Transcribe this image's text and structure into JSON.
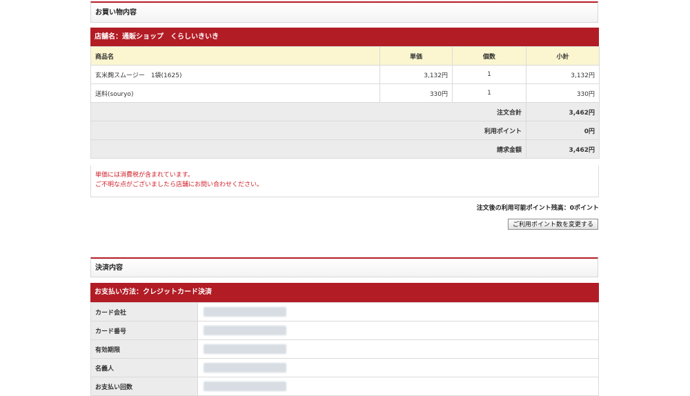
{
  "order": {
    "section_title": "お買い物内容",
    "shop_label": "店舗名：通販ショップ　くらしいきいき",
    "headers": {
      "name": "商品名",
      "unit_price": "単価",
      "qty": "個数",
      "subtotal": "小計"
    },
    "items": [
      {
        "name": "玄米麹スムージー　1袋(1625)",
        "unit_price": "3,132円",
        "qty": "1",
        "subtotal": "3,132円"
      },
      {
        "name": "送料(souryo)",
        "unit_price": "330円",
        "qty": "1",
        "subtotal": "330円"
      }
    ],
    "summary": [
      {
        "label": "注文合計",
        "value": "3,462円"
      },
      {
        "label": "利用ポイント",
        "value": "0円"
      },
      {
        "label": "請求金額",
        "value": "3,462円"
      }
    ],
    "notes": [
      "単価には消費税が含まれています。",
      "ご不明な点がございましたら店舗にお問い合わせください。"
    ],
    "points_balance": "注文後の利用可能ポイント残高：0ポイント",
    "change_points_button": "ご利用ポイント数を変更する"
  },
  "payment": {
    "section_title": "決済内容",
    "method_label": "お支払い方法：クレジットカード決済",
    "rows": [
      {
        "label": "カード会社"
      },
      {
        "label": "カード番号"
      },
      {
        "label": "有効期限"
      },
      {
        "label": "名義人"
      },
      {
        "label": "お支払い回数"
      }
    ]
  }
}
